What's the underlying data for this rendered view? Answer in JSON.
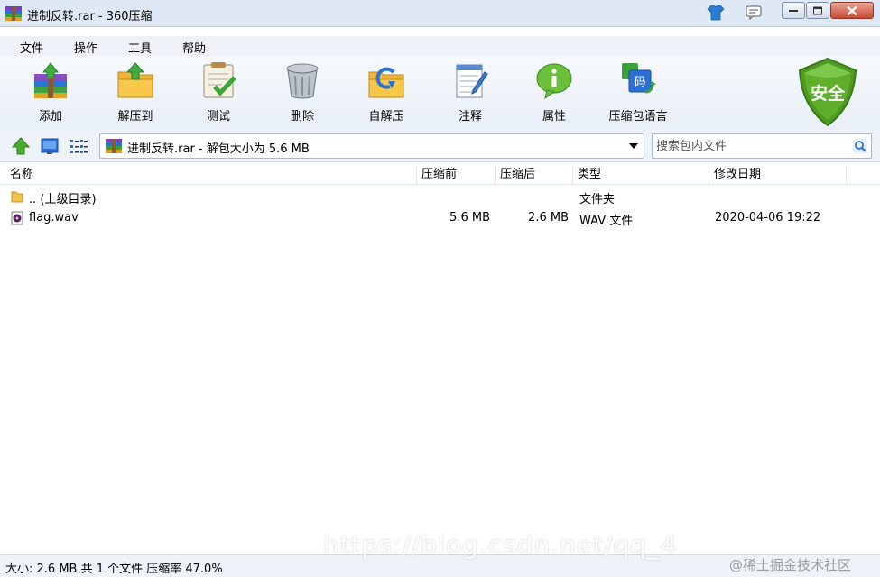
{
  "window": {
    "title": "进制反转.rar - 360压缩",
    "buttons": {
      "skin": "skin-icon",
      "feedback": "feedback-icon",
      "minimize": "minimize-icon",
      "maximize": "maximize-icon",
      "close": "close-icon"
    }
  },
  "menu": [
    {
      "label": "文件"
    },
    {
      "label": "操作"
    },
    {
      "label": "工具"
    },
    {
      "label": "帮助"
    }
  ],
  "toolbar": [
    {
      "label": "添加",
      "icon": "add-archive-icon"
    },
    {
      "label": "解压到",
      "icon": "extract-to-icon"
    },
    {
      "label": "测试",
      "icon": "test-clipboard-icon"
    },
    {
      "label": "删除",
      "icon": "trash-can-icon"
    },
    {
      "label": "自解压",
      "icon": "self-extract-icon"
    },
    {
      "label": "注释",
      "icon": "comment-notepad-icon"
    },
    {
      "label": "属性",
      "icon": "info-bubble-icon"
    },
    {
      "label": "压缩包语言",
      "icon": "language-icon"
    }
  ],
  "security": {
    "label": "安全",
    "color": "#5a9a2a"
  },
  "address": {
    "path": "进制反转.rar - 解包大小为 5.6 MB",
    "search_placeholder": "搜索包内文件"
  },
  "columns": {
    "name": "名称",
    "before": "压缩前",
    "after": "压缩后",
    "type": "类型",
    "date": "修改日期"
  },
  "files": [
    {
      "name": ".. (上级目录)",
      "before": "",
      "after": "",
      "type": "文件夹",
      "date": "",
      "icon": "folder-icon"
    },
    {
      "name": "flag.wav",
      "before": "5.6 MB",
      "after": "2.6 MB",
      "type": "WAV 文件",
      "date": "2020-04-06 19:22",
      "icon": "audio-file-icon"
    }
  ],
  "status": "大小: 2.6 MB 共 1 个文件 压缩率 47.0%",
  "watermark": "https://blog.csdn.net/qq_4",
  "watermark_brand": "@稀土掘金技术社区"
}
